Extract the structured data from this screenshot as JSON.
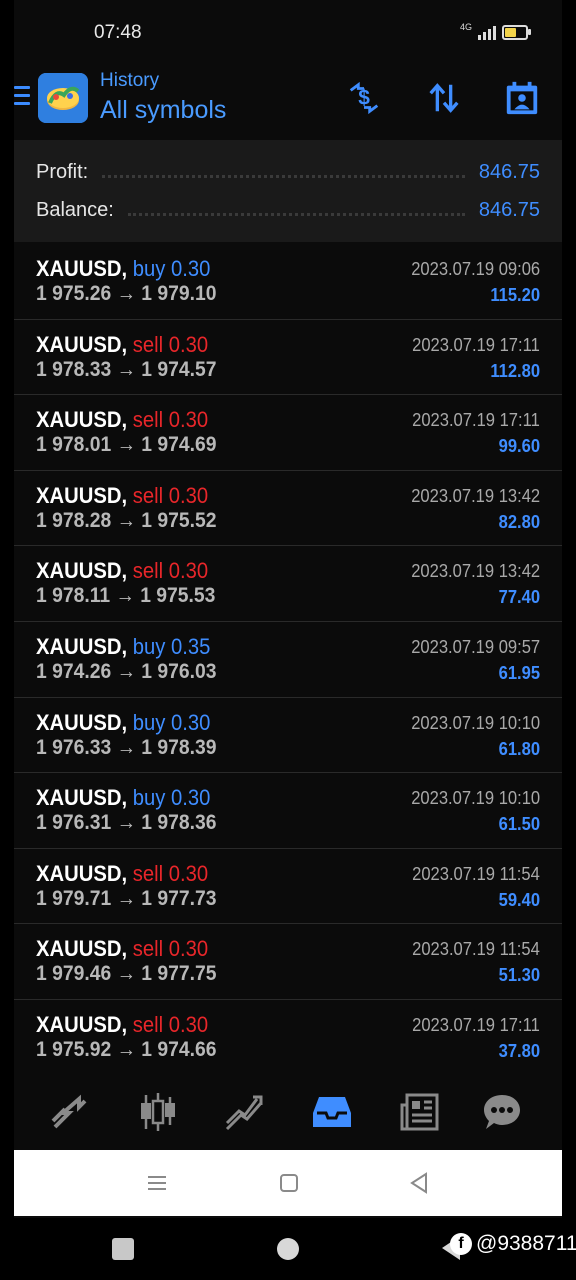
{
  "status_bar": {
    "time": "07:48",
    "network": "4G"
  },
  "header": {
    "subtitle": "History",
    "title": "All symbols"
  },
  "toolbar": {
    "icons": [
      "currency-exchange-icon",
      "sort-icon",
      "calendar-icon"
    ]
  },
  "summary": {
    "profit_label": "Profit:",
    "profit_value": "846.75",
    "balance_label": "Balance:",
    "balance_value": "846.75"
  },
  "trades": [
    {
      "symbol": "XAUUSD,",
      "side": "buy",
      "volume": "0.30",
      "prices": "1 975.26 → 1 979.10",
      "time": "2023.07.19 09:06",
      "profit": "115.20"
    },
    {
      "symbol": "XAUUSD,",
      "side": "sell",
      "volume": "0.30",
      "prices": "1 978.33 → 1 974.57",
      "time": "2023.07.19 17:11",
      "profit": "112.80"
    },
    {
      "symbol": "XAUUSD,",
      "side": "sell",
      "volume": "0.30",
      "prices": "1 978.01 → 1 974.69",
      "time": "2023.07.19 17:11",
      "profit": "99.60"
    },
    {
      "symbol": "XAUUSD,",
      "side": "sell",
      "volume": "0.30",
      "prices": "1 978.28 → 1 975.52",
      "time": "2023.07.19 13:42",
      "profit": "82.80"
    },
    {
      "symbol": "XAUUSD,",
      "side": "sell",
      "volume": "0.30",
      "prices": "1 978.11 → 1 975.53",
      "time": "2023.07.19 13:42",
      "profit": "77.40"
    },
    {
      "symbol": "XAUUSD,",
      "side": "buy",
      "volume": "0.35",
      "prices": "1 974.26 → 1 976.03",
      "time": "2023.07.19 09:57",
      "profit": "61.95"
    },
    {
      "symbol": "XAUUSD,",
      "side": "buy",
      "volume": "0.30",
      "prices": "1 976.33 → 1 978.39",
      "time": "2023.07.19 10:10",
      "profit": "61.80"
    },
    {
      "symbol": "XAUUSD,",
      "side": "buy",
      "volume": "0.30",
      "prices": "1 976.31 → 1 978.36",
      "time": "2023.07.19 10:10",
      "profit": "61.50"
    },
    {
      "symbol": "XAUUSD,",
      "side": "sell",
      "volume": "0.30",
      "prices": "1 979.71 → 1 977.73",
      "time": "2023.07.19 11:54",
      "profit": "59.40"
    },
    {
      "symbol": "XAUUSD,",
      "side": "sell",
      "volume": "0.30",
      "prices": "1 979.46 → 1 977.75",
      "time": "2023.07.19 11:54",
      "profit": "51.30"
    },
    {
      "symbol": "XAUUSD,",
      "side": "sell",
      "volume": "0.30",
      "prices": "1 975.92 → 1 974.66",
      "time": "2023.07.19 17:11",
      "profit": "37.80"
    }
  ],
  "colors": {
    "accent": "#3f8dff",
    "sell": "#e8262a",
    "buy": "#3f8dff",
    "background": "#0b0b0b"
  },
  "bottom_tabs": [
    "quotes-icon",
    "chart-icon",
    "trade-icon",
    "history-icon",
    "news-icon",
    "chat-icon"
  ],
  "active_tab": "history-icon",
  "watermark": {
    "text": "@9388711"
  }
}
